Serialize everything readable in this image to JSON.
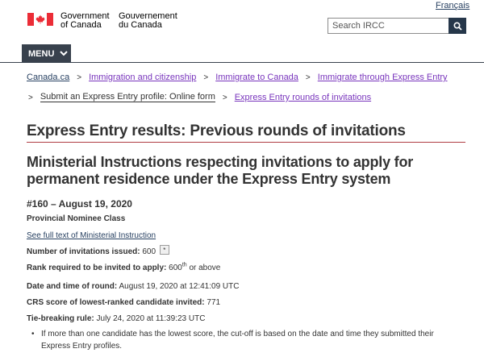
{
  "header": {
    "language_link": "Français",
    "signature_en_line1": "Government",
    "signature_en_line2": "of Canada",
    "signature_fr_line1": "Gouvernement",
    "signature_fr_line2": "du Canada",
    "search_placeholder": "Search IRCC",
    "menu_label": "MENU"
  },
  "breadcrumbs": {
    "items": [
      {
        "label": "Canada.ca"
      },
      {
        "label": "Immigration and citizenship"
      },
      {
        "label": "Immigrate to Canada"
      },
      {
        "label": "Immigrate through Express Entry"
      },
      {
        "label": "Submit an Express Entry profile: Online form"
      },
      {
        "label": "Express Entry rounds of invitations"
      }
    ],
    "separator": ">"
  },
  "main": {
    "title": "Express Entry results: Previous rounds of invitations",
    "subheading": "Ministerial Instructions respecting invitations to apply for permanent residence under the Express Entry system",
    "round_id": "#160 – August 19, 2020",
    "class_name": "Provincial Nominee Class",
    "instruction_link": "See full text of Ministerial Instruction",
    "facts": {
      "invitations_label": "Number of invitations issued:",
      "invitations_value": "600",
      "footnote_marker": "*",
      "rank_label": "Rank required to be invited to apply:",
      "rank_value": "600",
      "rank_suffix": "th",
      "rank_tail": "or above",
      "datetime_label": "Date and time of round:",
      "datetime_value": "August 19, 2020 at 12:41:09 UTC",
      "crs_label": "CRS score of lowest-ranked candidate invited:",
      "crs_value": "771",
      "tie_label": "Tie-breaking rule:",
      "tie_value": "July 24, 2020 at 11:39:23 UTC"
    },
    "bullets": [
      "If more than one candidate has the lowest score, the cut-off is based on the date and time they submitted their Express Entry profiles."
    ]
  },
  "colors": {
    "brand_navy": "#26374a",
    "menu_bg": "#38414d",
    "link": "#284162",
    "visited_link": "#7834bc",
    "title_rule": "#af3c43",
    "flag_red": "#eb2d37"
  },
  "icons": {
    "search": "search-icon",
    "menu_chevron": "chevron-down-icon",
    "flag": "canada-flag-icon"
  }
}
